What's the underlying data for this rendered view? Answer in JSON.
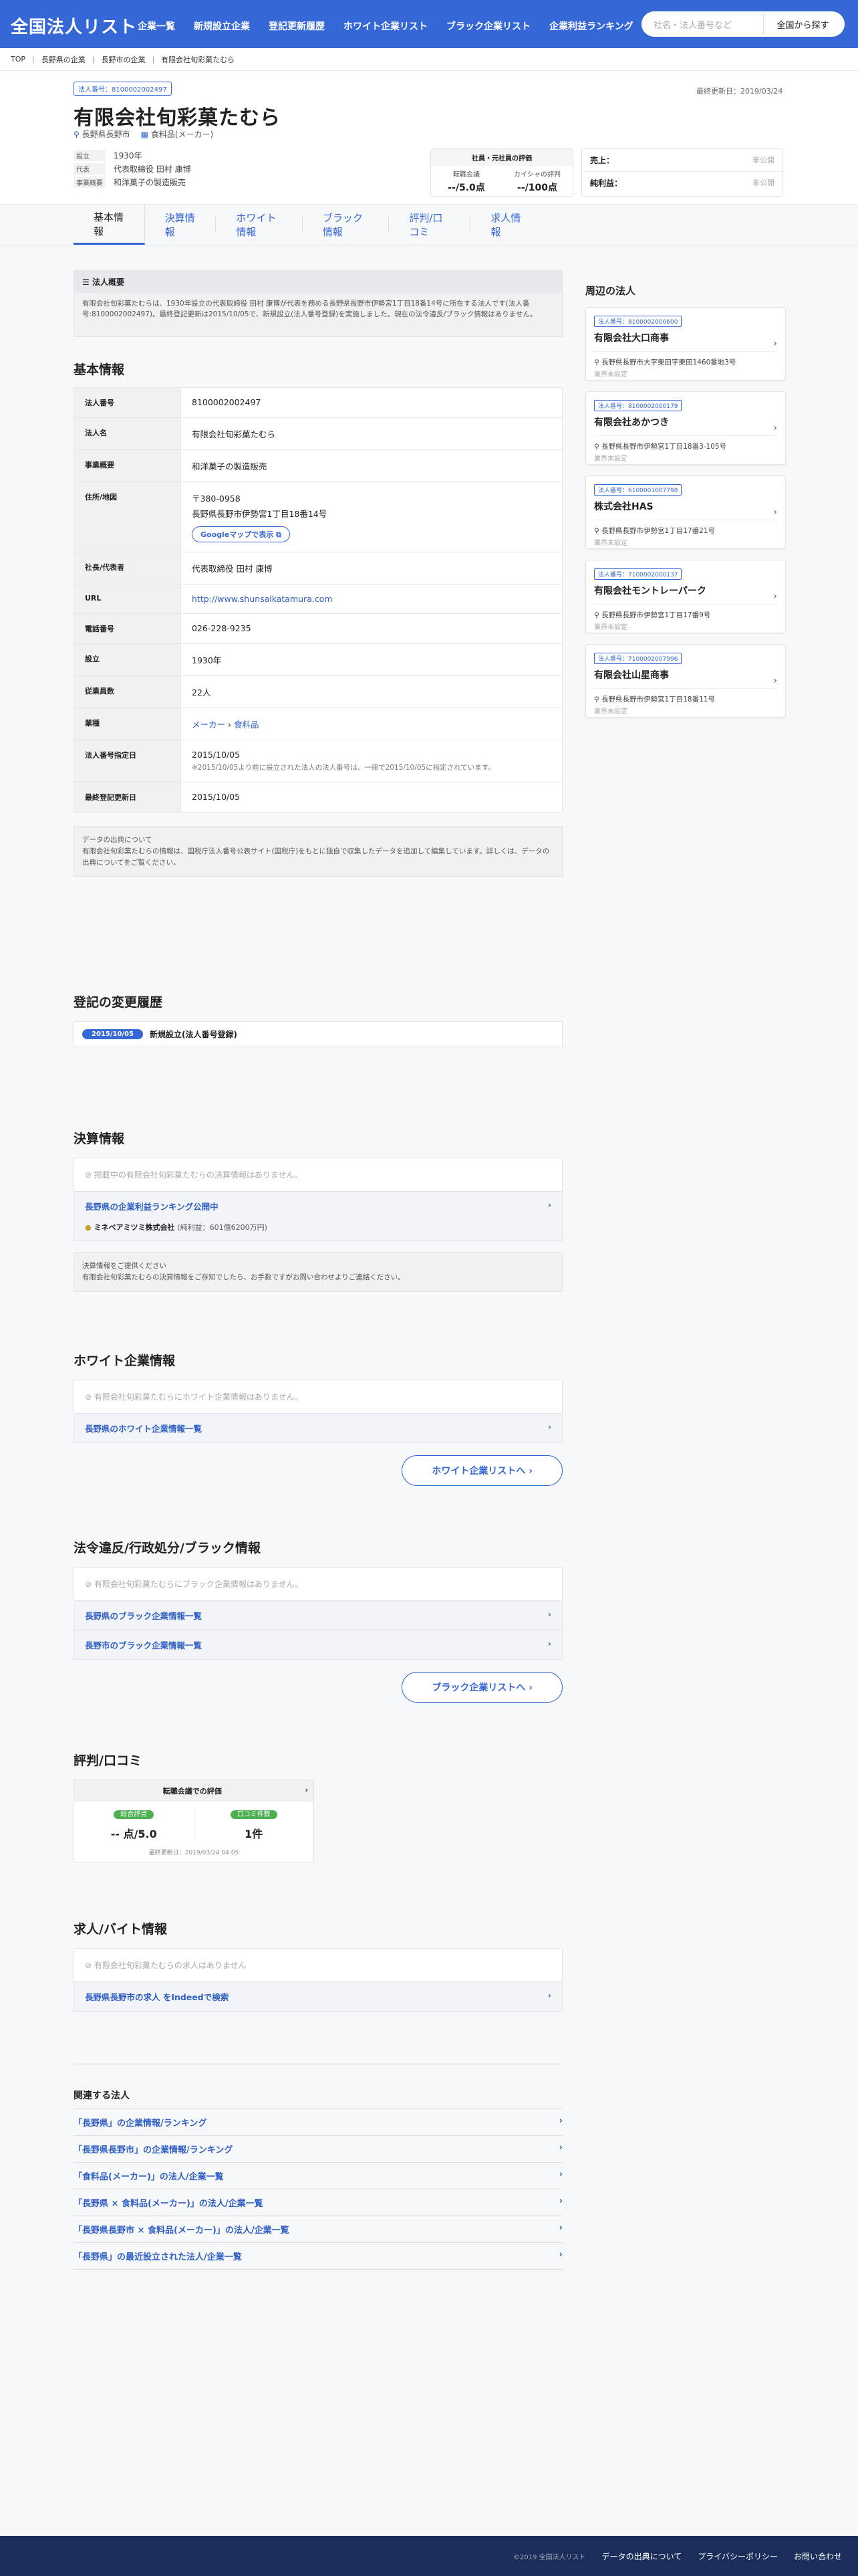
{
  "header": {
    "logo": "全国法人リスト",
    "nav": [
      "企業一覧",
      "新規設立企業",
      "登記更新履歴",
      "ホワイト企業リスト",
      "ブラック企業リスト",
      "企業利益ランキング"
    ],
    "search_placeholder": "社名・法人番号など",
    "search_button": "全国から探す"
  },
  "breadcrumb": [
    "TOP",
    "長野県の企業",
    "長野市の企業",
    "有限会社旬彩菓たむら"
  ],
  "company": {
    "corp_no_badge": "法人番号：8100002002497",
    "updated": "最終更新日：2019/03/24",
    "name": "有限会社旬彩菓たむら",
    "location": "長野県長野市",
    "category": "食料品(メーカー)",
    "rows": [
      {
        "k": "設立",
        "v": "1930年"
      },
      {
        "k": "代表",
        "v": "代表取締役 田村 康博"
      },
      {
        "k": "事業概要",
        "v": "和洋菓子の製造販売"
      }
    ],
    "eval_title": "社員・元社員の評価",
    "eval_labels": [
      "転職会議",
      "カイシャの評判"
    ],
    "eval_values": [
      "--/5.0点",
      "--/100点"
    ],
    "fin_labels": [
      "売上：",
      "純利益："
    ],
    "fin_values": [
      "非公開",
      "非公開"
    ]
  },
  "tabs": [
    "基本情報",
    "決算情報",
    "ホワイト情報",
    "ブラック情報",
    "評判/口コミ",
    "求人情報"
  ],
  "summary": {
    "title": "法人概要",
    "text": "有限会社旬彩菓たむらは、1930年設立の代表取締役 田村 康博が代表を務める長野県長野市伊勢宮1丁目18番14号に所在する法人です(法人番号:8100002002497)。最終登記更新は2015/10/05で、新規設立(法人番号登録)を実施しました。現在の法令違反/ブラック情報はありません。"
  },
  "basic": {
    "title": "基本情報",
    "rows": [
      {
        "k": "法人番号",
        "v": "8100002002497"
      },
      {
        "k": "法人名",
        "v": "有限会社旬彩菓たむら"
      },
      {
        "k": "事業概要",
        "v": "和洋菓子の製造販売"
      },
      {
        "k": "住所/地図",
        "v": "〒380-0958",
        "v2": "長野県長野市伊勢宮1丁目18番14号",
        "btn": "Googleマップで表示"
      },
      {
        "k": "社長/代表者",
        "v": "代表取締役 田村 康博"
      },
      {
        "k": "URL",
        "v": "http://www.shunsaikatamura.com"
      },
      {
        "k": "電話番号",
        "v": "026-228-9235"
      },
      {
        "k": "設立",
        "v": "1930年"
      },
      {
        "k": "従業員数",
        "v": "22人"
      },
      {
        "k": "業種",
        "v": "メーカー",
        "v2": "食料品"
      },
      {
        "k": "法人番号指定日",
        "v": "2015/10/05",
        "v2": "※2015/10/05より前に設立された法人の法人番号は、一律で2015/10/05に指定されています。"
      },
      {
        "k": "最終登記更新日",
        "v": "2015/10/05"
      }
    ]
  },
  "source": {
    "title": "データの出典について",
    "text": "有限会社旬彩菓たむらの情報は、国税庁法人番号公表サイト(国税庁)をもとに独自で収集したデータを追加して編集しています。詳しくは、データの出典についてをご覧ください。"
  },
  "history": {
    "title": "登記の変更履歴",
    "date": "2015/10/05",
    "text": "新規設立(法人番号登録)"
  },
  "settlement": {
    "title": "決算情報",
    "empty": "掲載中の有限会社旬彩菓たむらの決算情報はありません。",
    "link": "長野県の企業利益ランキング公開中",
    "first": "ミネベアミツミ株式会社",
    "first_val": "(純利益：601億6200万円)",
    "note_title": "決算情報をご提供ください",
    "note": "有限会社旬彩菓たむらの決算情報をご存知でしたら、お手数ですがお問い合わせよりご連絡ください。"
  },
  "white": {
    "title": "ホワイト企業情報",
    "empty": "有限会社旬彩菓たむらにホワイト企業情報はありません。",
    "link": "長野県のホワイト企業情報一覧",
    "btn": "ホワイト企業リストへ"
  },
  "black": {
    "title": "法令違反/行政処分/ブラック情報",
    "empty": "有限会社旬彩菓たむらにブラック企業情報はありません。",
    "links": [
      "長野県のブラック企業情報一覧",
      "長野市のブラック企業情報一覧"
    ],
    "btn": "ブラック企業リストへ"
  },
  "review": {
    "title": "評判/口コミ",
    "card": "転職会議での評価",
    "l1": "総合評点",
    "l2": "口コミ件数",
    "v1": "-- 点/5.0",
    "v2": "1件",
    "upd": "最終更新日：2019/03/24 04:05"
  },
  "jobs": {
    "title": "求人/バイト情報",
    "empty": "有限会社旬彩菓たむらの求人はありません",
    "link": "長野県長野市の求人 をIndeedで検索"
  },
  "related": {
    "title": "関連する法人",
    "links": [
      "「長野県」の企業情報/ランキング",
      "「長野県長野市」の企業情報/ランキング",
      "「食料品(メーカー)」の法人/企業一覧",
      "「長野県 × 食料品(メーカー)」の法人/企業一覧",
      "「長野県長野市 × 食料品(メーカー)」の法人/企業一覧",
      "「長野県」の最近設立された法人/企業一覧"
    ]
  },
  "nearby": {
    "title": "周辺の法人",
    "cards": [
      {
        "no": "法人番号：8100002000600",
        "name": "有限会社大口商事",
        "addr": "長野県長野市大字栗田字栗田1460番地3号",
        "cat": "業界未設定"
      },
      {
        "no": "法人番号：8100002000179",
        "name": "有限会社あかつき",
        "addr": "長野県長野市伊勢宮1丁目18番3-105号",
        "cat": "業界未設定"
      },
      {
        "no": "法人番号：6100001007798",
        "name": "株式会社HAS",
        "addr": "長野県長野市伊勢宮1丁目17番21号",
        "cat": "業界未設定"
      },
      {
        "no": "法人番号：7100002000137",
        "name": "有限会社モントレーパーク",
        "addr": "長野県長野市伊勢宮1丁目17番9号",
        "cat": "業界未設定"
      },
      {
        "no": "法人番号：7100002007996",
        "name": "有限会社山星商事",
        "addr": "長野県長野市伊勢宮1丁目18番11号",
        "cat": "業界未設定"
      }
    ]
  },
  "footer": {
    "copy": "©2019 全国法人リスト",
    "links": [
      "データの出典について",
      "プライバシーポリシー",
      "お問い合わせ"
    ]
  }
}
